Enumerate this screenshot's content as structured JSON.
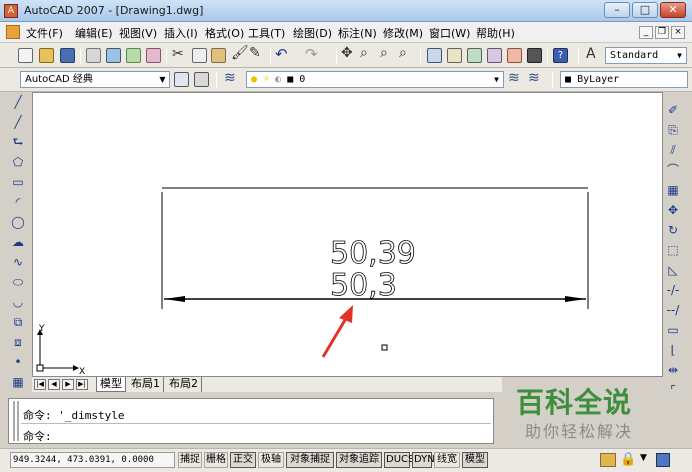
{
  "window": {
    "title": "AutoCAD 2007 - [Drawing1.dwg]",
    "minimize": "–",
    "maximize": "□",
    "close": "✕"
  },
  "menu": {
    "items": [
      "文件(F)",
      "编辑(E)",
      "视图(V)",
      "插入(I)",
      "格式(O)",
      "工具(T)",
      "绘图(D)",
      "标注(N)",
      "修改(M)",
      "窗口(W)",
      "帮助(H)"
    ],
    "doc_min": "_",
    "doc_restore": "❐",
    "doc_close": "×"
  },
  "toolbar": {
    "text_style": "Standard",
    "workspace": "AutoCAD 经典",
    "layer": "0",
    "color": "ByLayer"
  },
  "drawing": {
    "dim_text_top": "50,39",
    "dim_text_bottom": "50,3",
    "ucs_x": "X",
    "ucs_y": "Y"
  },
  "layout_tabs": [
    "模型",
    "布局1",
    "布局2"
  ],
  "command": {
    "history": "命令: '_dimstyle",
    "prompt": "命令:"
  },
  "status": {
    "coords": "949.3244, 473.0391, 0.0000",
    "buttons": [
      "捕捉",
      "栅格",
      "正交",
      "极轴",
      "对象捕捉",
      "对象追踪",
      "DUCS",
      "DYN",
      "线宽",
      "模型"
    ]
  },
  "watermark": {
    "title": "百科全说",
    "subtitle": "助你轻松解决"
  },
  "colors": {
    "arrow": "#e0342a",
    "brand_green": "#3d8f3d",
    "title_bar": "#a9c8ea"
  }
}
